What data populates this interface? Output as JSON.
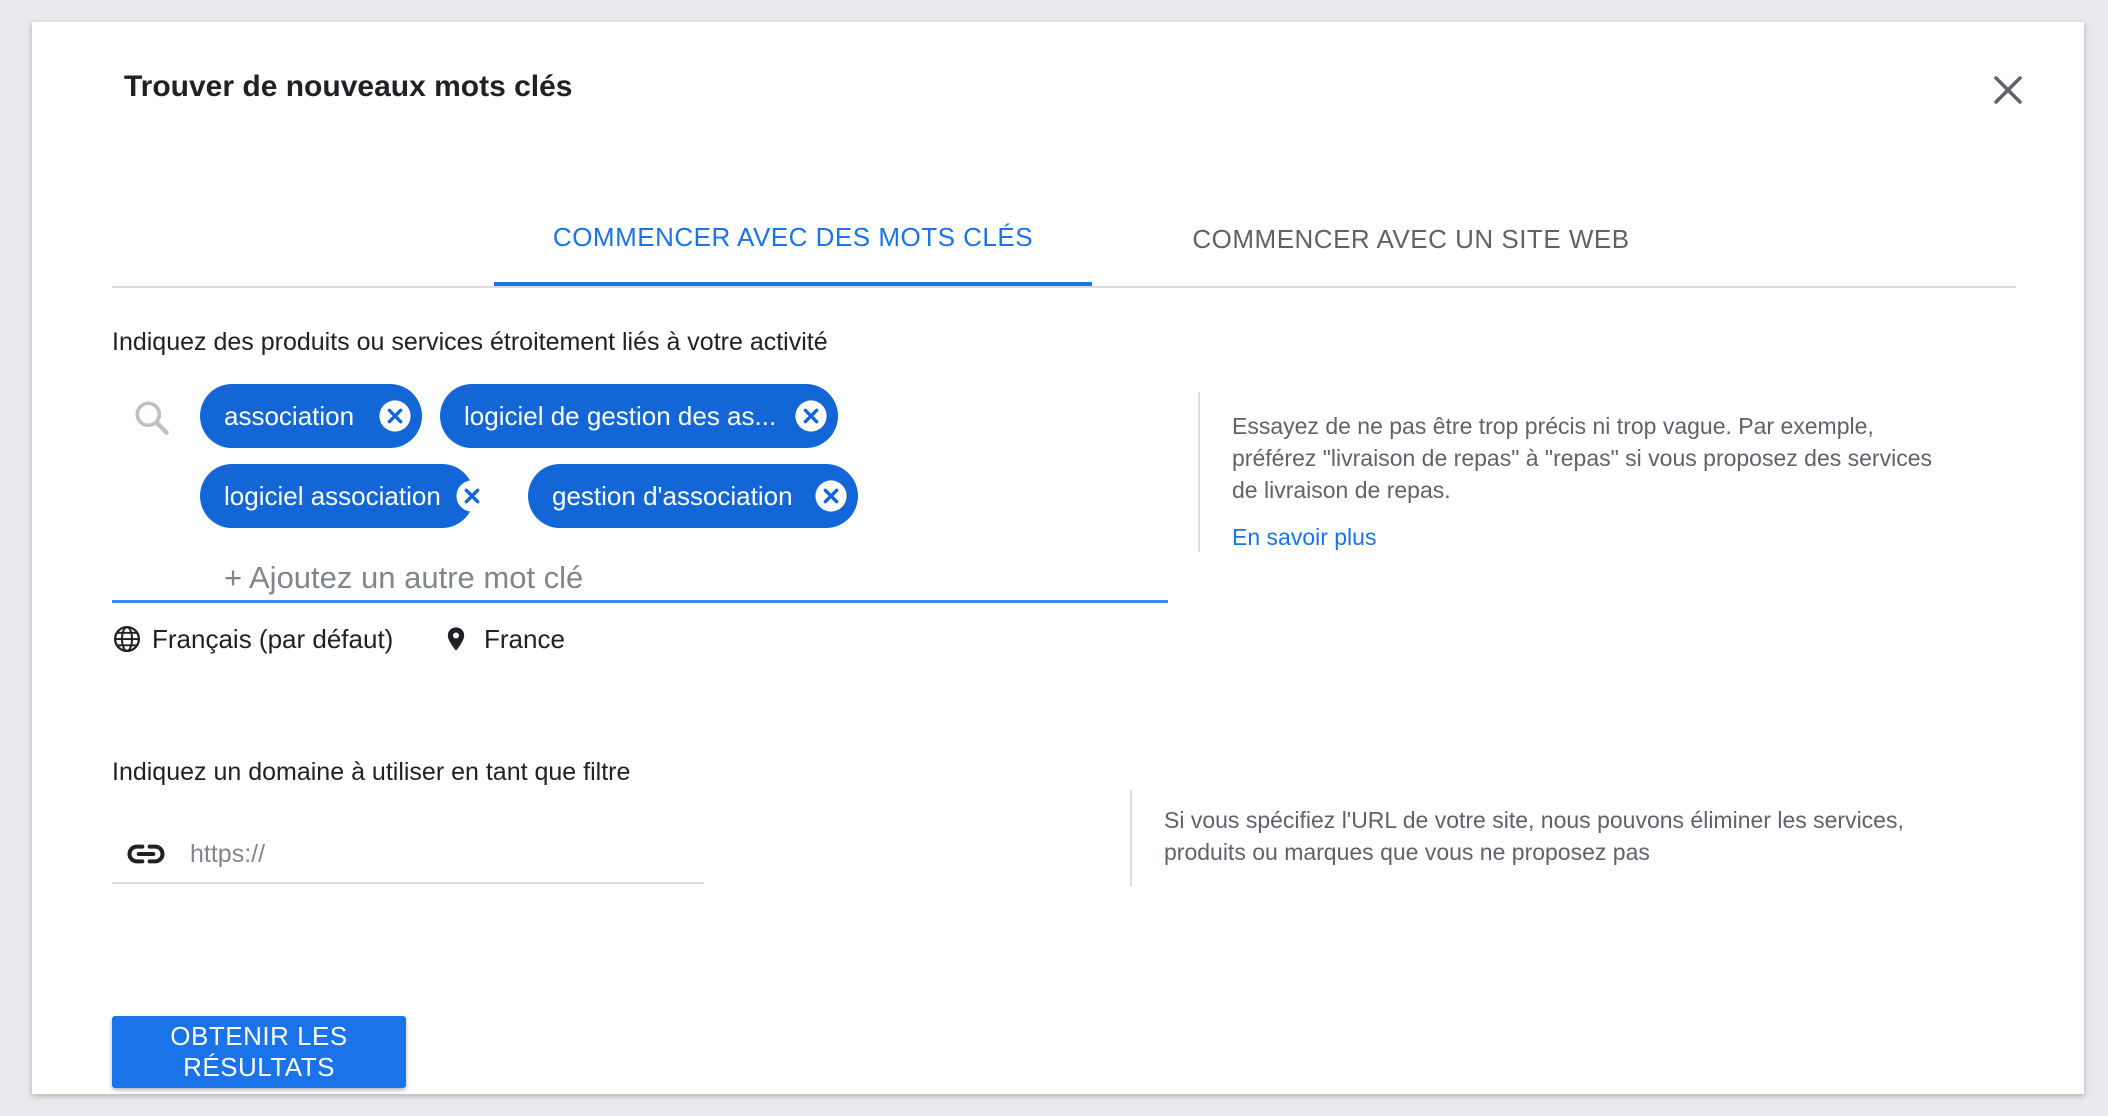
{
  "dialog": {
    "title": "Trouver de nouveaux mots clés",
    "close_icon": "close-icon"
  },
  "tabs": [
    {
      "label": "COMMENCER AVEC DES MOTS CLÉS",
      "active": true
    },
    {
      "label": "COMMENCER AVEC UN SITE WEB",
      "active": false
    }
  ],
  "keywords_section": {
    "label": "Indiquez des produits ou services étroitement liés à votre activité",
    "search_icon": "search-icon",
    "chips": [
      "association",
      "logiciel de gestion des as...",
      "logiciel association",
      "gestion d'association"
    ],
    "add_placeholder": "+ Ajoutez un autre mot clé",
    "language": "Français (par défaut)",
    "location": "France",
    "hint": "Essayez de ne pas être trop précis ni trop vague. Par exemple, préférez \"livraison de repas\" à \"repas\" si vous proposez des services de livraison de repas.",
    "learn_more": "En savoir plus"
  },
  "domain_section": {
    "label": "Indiquez un domaine à utiliser en tant que filtre",
    "placeholder": "https://",
    "link_icon": "link-icon",
    "hint": "Si vous spécifiez l'URL de votre site, nous pouvons éliminer les services, produits ou marques que vous ne proposez pas"
  },
  "actions": {
    "submit": "OBTENIR LES RÉSULTATS"
  },
  "colors": {
    "accent": "#1a73e8",
    "chip": "#1266d6",
    "text": "#202124",
    "muted": "#5f6368"
  }
}
